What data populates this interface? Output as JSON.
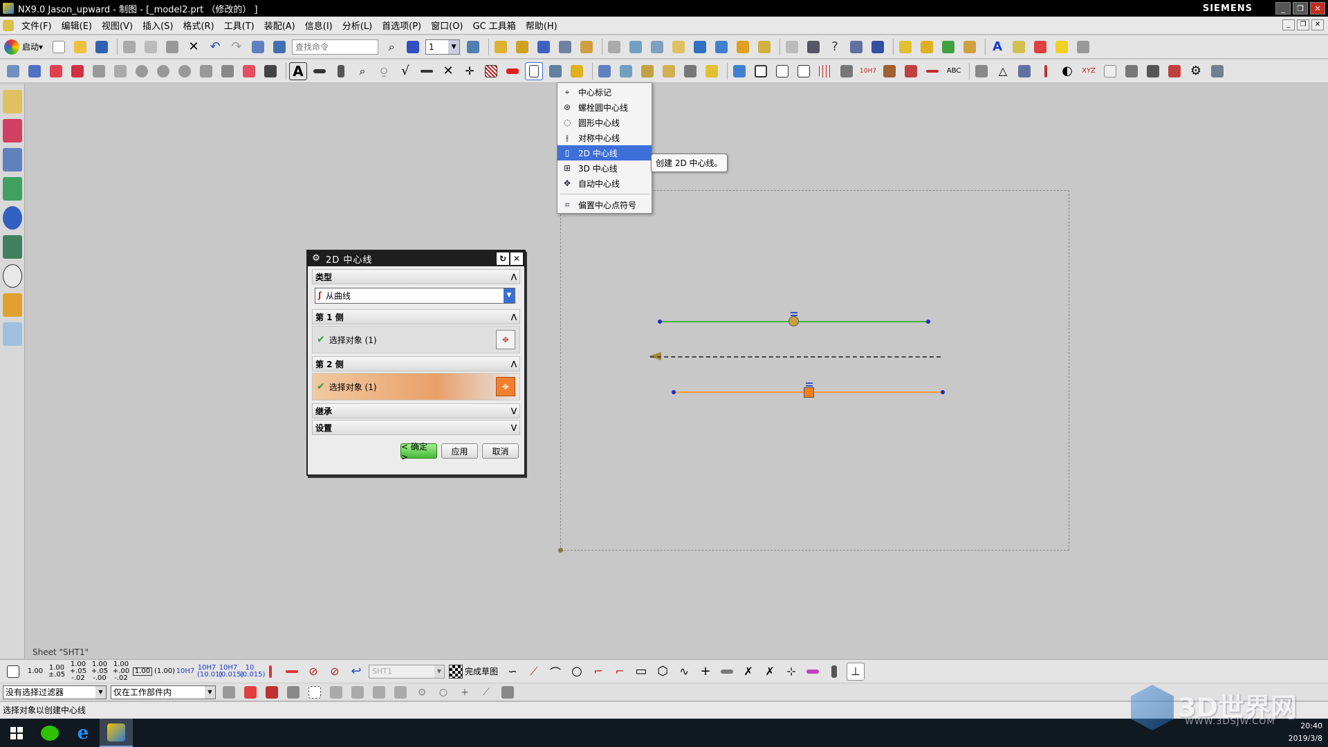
{
  "window": {
    "title": "NX9.0 Jason_upward - 制图 - [_model2.prt （修改的） ]",
    "brand": "SIEMENS",
    "controls": [
      "_",
      "❐",
      "✕"
    ]
  },
  "menu": [
    "文件(F)",
    "编辑(E)",
    "视图(V)",
    "插入(S)",
    "格式(R)",
    "工具(T)",
    "装配(A)",
    "信息(I)",
    "分析(L)",
    "首选项(P)",
    "窗口(O)",
    "GC 工具箱",
    "帮助(H)"
  ],
  "toolbar": {
    "launch_label": "启动",
    "search_placeholder": "查找命令",
    "layer_value": "1"
  },
  "colors": {
    "green_line": "#3cb43c",
    "orange_line": "#ff9933",
    "selected_menu": "#3d6fd8",
    "ok_button": "#48b838"
  },
  "dropdown": {
    "items": [
      {
        "label": "中心标记",
        "icon": "center-mark-icon",
        "glyph": "⌖"
      },
      {
        "label": "螺栓圆中心线",
        "icon": "bolt-circle-icon",
        "glyph": "⊛"
      },
      {
        "label": "圆形中心线",
        "icon": "circular-centerline-icon",
        "glyph": "◌"
      },
      {
        "label": "对称中心线",
        "icon": "symmetric-centerline-icon",
        "glyph": "⫲"
      },
      {
        "label": "2D 中心线",
        "icon": "2d-centerline-icon",
        "glyph": "▯",
        "selected": true
      },
      {
        "label": "3D 中心线",
        "icon": "3d-centerline-icon",
        "glyph": "⊞"
      },
      {
        "label": "自动中心线",
        "icon": "auto-centerline-icon",
        "glyph": "✥"
      }
    ],
    "extra_item": {
      "label": "偏置中心点符号",
      "icon": "offset-center-symbol-icon",
      "glyph": "⌗"
    },
    "tooltip": "创建 2D 中心线。"
  },
  "dialog": {
    "title": "2D 中心线",
    "sections": {
      "type": "类型",
      "side1": "第 1 侧",
      "side2": "第 2 侧",
      "inherit": "继承",
      "settings": "设置"
    },
    "type_value": "从曲线",
    "side1_select": "选择对象 (1)",
    "side2_select": "选择对象 (1)",
    "buttons": {
      "ok": "< 确定 >",
      "apply": "应用",
      "cancel": "取消"
    }
  },
  "canvas": {
    "sheet_label": "Sheet \"SHT1\""
  },
  "bottom_toolbar": {
    "dims": [
      "1.00",
      "1.00\n±.05",
      "1.00\n+.05\n-.02",
      "1.00\n+.05\n-.00",
      "1.00\n+.00\n-.02",
      "1.00",
      "(1.00)",
      "10H7",
      "10H7\n(10.01)",
      "10H7\n(0.015)",
      "10\n(0.015)"
    ],
    "sheet_select": "SHT1",
    "finish_sketch": "完成草图"
  },
  "filter_bar": {
    "selection_filter": "没有选择过滤器",
    "scope": "仅在工作部件内"
  },
  "status": "选择对象以创建中心线",
  "taskbar": {
    "time": "20:40",
    "date": "2019/3/8"
  },
  "watermark": {
    "text": "3D世界网",
    "url": "WWW.3DSJW.COM"
  }
}
